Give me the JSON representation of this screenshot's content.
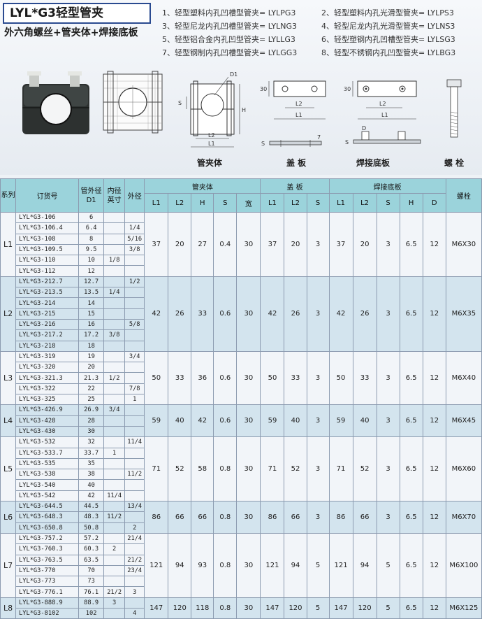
{
  "header": {
    "title": "LYL*G3轻型管夹",
    "subtitle": "外六角螺丝+管夹体+焊接底板",
    "models": [
      "1、轻型塑料内孔凹槽型管夹= LYLPG3",
      "2、轻型塑料内孔光滑型管夹= LYLPS3",
      "3、轻型尼龙内孔凹槽型管夹= LYLNG3",
      "4、轻型尼龙内孔光滑型管夹= LYLNS3",
      "5、轻型铝合金内孔凹型管夹= LYLLG3",
      "6、轻型塑钢内孔凹槽型管夹= LYLSG3",
      "7、轻型钢制内孔凹槽型管夹= LYLGG3",
      "8、轻型不锈钢内孔凹型管夹= LYLBG3"
    ]
  },
  "drawings": {
    "captions": {
      "body": "管夹体",
      "cover": "盖  板",
      "base": "焊接底板",
      "bolt": "螺  栓"
    },
    "dims": {
      "d1": "D1",
      "h": "H",
      "s": "S",
      "l1": "L1",
      "l2": "L2",
      "d": "D",
      "n30": "30",
      "n7": "7"
    }
  },
  "table": {
    "head": {
      "series": "系列",
      "order": "订货号",
      "od_line1": "管外径",
      "od_line2": "D1",
      "inch_line1": "内径",
      "inch_line2": "英寸",
      "outer": "外径",
      "g_body": "管夹体",
      "g_cover": "盖  板",
      "g_base": "焊接底板",
      "bolt": "螺栓",
      "sub": [
        "L1",
        "L2",
        "H",
        "S",
        "宽",
        "L1",
        "L2",
        "S",
        "L1",
        "L2",
        "S",
        "H",
        "D"
      ]
    },
    "groups": [
      {
        "series": "L1",
        "dims": [
          "37",
          "20",
          "27",
          "0.4",
          "30",
          "37",
          "20",
          "3",
          "37",
          "20",
          "3",
          "6.5",
          "12"
        ],
        "bolt": "M6X30",
        "rows": [
          [
            "LYL*G3-106",
            "6",
            "",
            ""
          ],
          [
            "LYL*G3-106.4",
            "6.4",
            "",
            "1/4"
          ],
          [
            "LYL*G3-108",
            "8",
            "",
            "5/16"
          ],
          [
            "LYL*G3-109.5",
            "9.5",
            "",
            "3/8"
          ],
          [
            "LYL*G3-110",
            "10",
            "1/8",
            ""
          ],
          [
            "LYL*G3-112",
            "12",
            "",
            ""
          ]
        ]
      },
      {
        "series": "L2",
        "dims": [
          "42",
          "26",
          "33",
          "0.6",
          "30",
          "42",
          "26",
          "3",
          "42",
          "26",
          "3",
          "6.5",
          "12"
        ],
        "bolt": "M6X35",
        "rows": [
          [
            "LYL*G3-212.7",
            "12.7",
            "",
            "1/2"
          ],
          [
            "LYL*G3-213.5",
            "13.5",
            "1/4",
            ""
          ],
          [
            "LYL*G3-214",
            "14",
            "",
            ""
          ],
          [
            "LYL*G3-215",
            "15",
            "",
            ""
          ],
          [
            "LYL*G3-216",
            "16",
            "",
            "5/8"
          ],
          [
            "LYL*G3-217.2",
            "17.2",
            "3/8",
            ""
          ],
          [
            "LYL*G3-218",
            "18",
            "",
            ""
          ]
        ]
      },
      {
        "series": "L3",
        "dims": [
          "50",
          "33",
          "36",
          "0.6",
          "30",
          "50",
          "33",
          "3",
          "50",
          "33",
          "3",
          "6.5",
          "12"
        ],
        "bolt": "M6X40",
        "rows": [
          [
            "LYL*G3-319",
            "19",
            "",
            "3/4"
          ],
          [
            "LYL*G3-320",
            "20",
            "",
            ""
          ],
          [
            "LYL*G3-321.3",
            "21.3",
            "1/2",
            ""
          ],
          [
            "LYL*G3-322",
            "22",
            "",
            "7/8"
          ],
          [
            "LYL*G3-325",
            "25",
            "",
            "1"
          ]
        ]
      },
      {
        "series": "L4",
        "dims": [
          "59",
          "40",
          "42",
          "0.6",
          "30",
          "59",
          "40",
          "3",
          "59",
          "40",
          "3",
          "6.5",
          "12"
        ],
        "bolt": "M6X45",
        "rows": [
          [
            "LYL*G3-426.9",
            "26.9",
            "3/4",
            ""
          ],
          [
            "LYL*G3-428",
            "28",
            "",
            ""
          ],
          [
            "LYL*G3-430",
            "30",
            "",
            ""
          ]
        ]
      },
      {
        "series": "L5",
        "dims": [
          "71",
          "52",
          "58",
          "0.8",
          "30",
          "71",
          "52",
          "3",
          "71",
          "52",
          "3",
          "6.5",
          "12"
        ],
        "bolt": "M6X60",
        "rows": [
          [
            "LYL*G3-532",
            "32",
            "",
            "11/4"
          ],
          [
            "LYL*G3-533.7",
            "33.7",
            "1",
            ""
          ],
          [
            "LYL*G3-535",
            "35",
            "",
            ""
          ],
          [
            "LYL*G3-538",
            "38",
            "",
            "11/2"
          ],
          [
            "LYL*G3-540",
            "40",
            "",
            ""
          ],
          [
            "LYL*G3-542",
            "42",
            "11/4",
            ""
          ]
        ]
      },
      {
        "series": "L6",
        "dims": [
          "86",
          "66",
          "66",
          "0.8",
          "30",
          "86",
          "66",
          "3",
          "86",
          "66",
          "3",
          "6.5",
          "12"
        ],
        "bolt": "M6X70",
        "rows": [
          [
            "LYL*G3-644.5",
            "44.5",
            "",
            "13/4"
          ],
          [
            "LYL*G3-648.3",
            "48.3",
            "11/2",
            ""
          ],
          [
            "LYL*G3-650.8",
            "50.8",
            "",
            "2"
          ]
        ]
      },
      {
        "series": "L7",
        "dims": [
          "121",
          "94",
          "93",
          "0.8",
          "30",
          "121",
          "94",
          "5",
          "121",
          "94",
          "5",
          "6.5",
          "12"
        ],
        "bolt": "M6X100",
        "rows": [
          [
            "LYL*G3-757.2",
            "57.2",
            "",
            "21/4"
          ],
          [
            "LYL*G3-760.3",
            "60.3",
            "2",
            ""
          ],
          [
            "LYL*G3-763.5",
            "63.5",
            "",
            "21/2"
          ],
          [
            "LYL*G3-770",
            "70",
            "",
            "23/4"
          ],
          [
            "LYL*G3-773",
            "73",
            "",
            ""
          ],
          [
            "LYL*G3-776.1",
            "76.1",
            "21/2",
            "3"
          ]
        ]
      },
      {
        "series": "L8",
        "dims": [
          "147",
          "120",
          "118",
          "0.8",
          "30",
          "147",
          "120",
          "5",
          "147",
          "120",
          "5",
          "6.5",
          "12"
        ],
        "bolt": "M6X125",
        "rows": [
          [
            "LYL*G3-888.9",
            "88.9",
            "3",
            ""
          ],
          [
            "LYL*G3-8102",
            "102",
            "",
            "4"
          ]
        ]
      }
    ]
  }
}
